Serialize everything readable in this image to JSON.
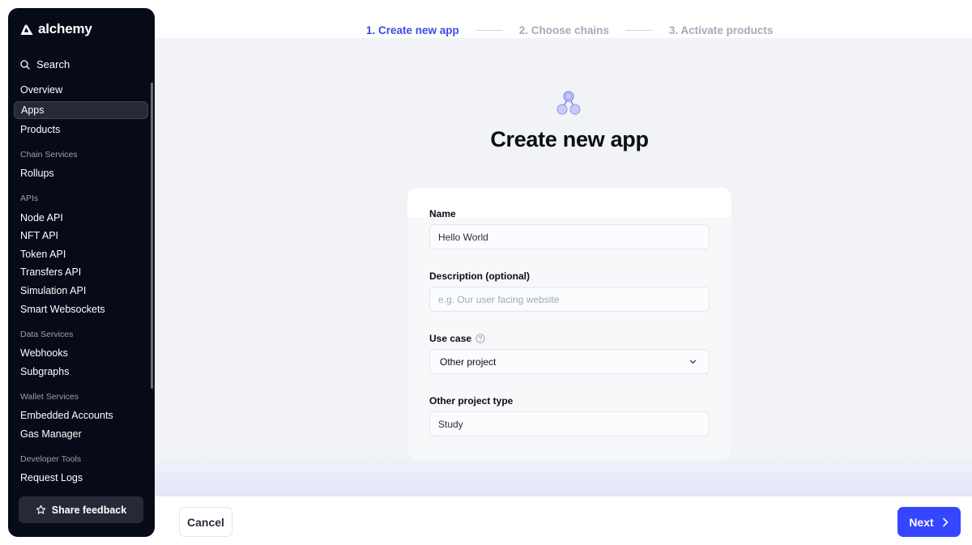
{
  "brand": {
    "name": "alchemy"
  },
  "sidebar": {
    "search_label": "Search",
    "items": {
      "overview": "Overview",
      "apps": "Apps",
      "products": "Products",
      "rollups": "Rollups",
      "node_api": "Node API",
      "nft_api": "NFT API",
      "token_api": "Token API",
      "transfers_api": "Transfers API",
      "simulation_api": "Simulation API",
      "smart_websockets": "Smart Websockets",
      "webhooks": "Webhooks",
      "subgraphs": "Subgraphs",
      "embedded_accounts": "Embedded Accounts",
      "gas_manager": "Gas Manager",
      "request_logs": "Request Logs"
    },
    "sections": {
      "chain_services": "Chain Services",
      "apis": "APIs",
      "data_services": "Data Services",
      "wallet_services": "Wallet Services",
      "developer_tools": "Developer Tools"
    },
    "active_item": "Apps",
    "feedback_label": "Share feedback"
  },
  "stepper": {
    "steps": [
      "1. Create new app",
      "2. Choose chains",
      "3. Activate products"
    ],
    "active_index": 0
  },
  "form": {
    "title": "Create new app",
    "name": {
      "label": "Name",
      "value": "Hello World"
    },
    "description": {
      "label": "Description (optional)",
      "placeholder": "e.g. Our user facing website"
    },
    "use_case": {
      "label": "Use case",
      "value": "Other project"
    },
    "other_type": {
      "label": "Other project type",
      "value": "Study"
    }
  },
  "footer": {
    "cancel_label": "Cancel",
    "next_label": "Next"
  },
  "colors": {
    "accent": "#3446ff",
    "step_active": "#3a4ce6",
    "sidebar_bg": "#070a17"
  }
}
